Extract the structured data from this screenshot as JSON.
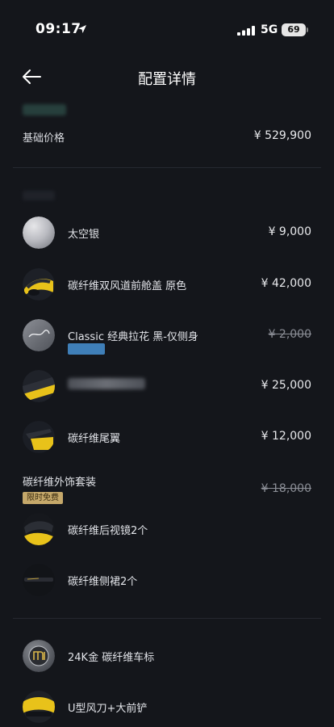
{
  "status_bar": {
    "time": "09:17",
    "network": "5G",
    "battery": "69"
  },
  "nav": {
    "title": "配置详情"
  },
  "base_price": {
    "label": "基础价格",
    "value": "¥ 529,900"
  },
  "items": [
    {
      "name": "太空银",
      "price": "¥ 9,000"
    },
    {
      "name": "碳纤维双风道前舱盖 原色",
      "price": "¥ 42,000"
    },
    {
      "name": "Classic 经典拉花 黑-仅侧身",
      "price": "¥ 2,000"
    },
    {
      "name": "",
      "price": "¥ 25,000"
    },
    {
      "name": "碳纤维尾翼",
      "price": "¥ 12,000"
    }
  ],
  "package": {
    "title": "碳纤维外饰套装",
    "badge": "限时免费",
    "price": "¥ 18,000",
    "sub_items": [
      {
        "name": "碳纤维后视镜2个"
      },
      {
        "name": "碳纤维侧裙2个"
      }
    ]
  },
  "extras": [
    {
      "name": "24K金 碳纤维车标"
    },
    {
      "name": "U型风刀+大前铲"
    }
  ],
  "colors": {
    "background": "#14161b",
    "badge": "#c5a86a",
    "accent_yellow": "#e8c21a",
    "chip_blue": "#3f7fb8"
  }
}
